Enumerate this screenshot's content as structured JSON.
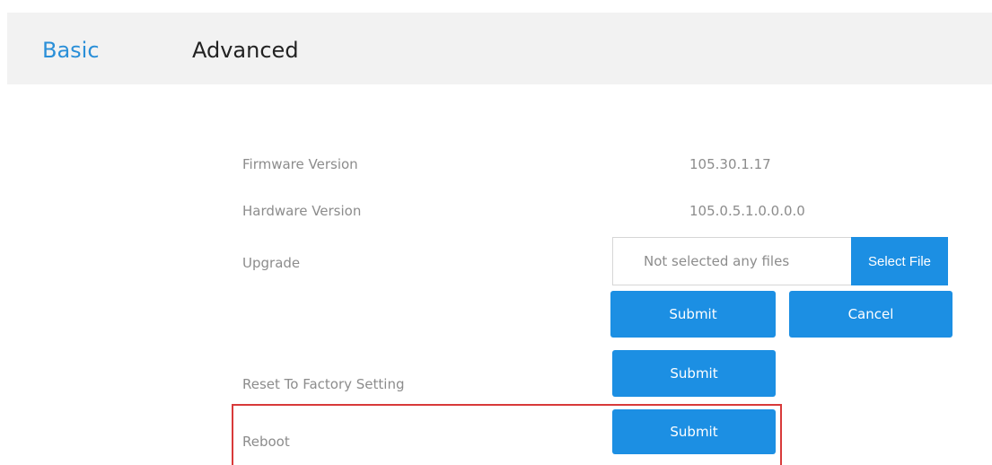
{
  "tabs": {
    "basic": "Basic",
    "advanced": "Advanced"
  },
  "firmware": {
    "label": "Firmware Version",
    "value": "105.30.1.17"
  },
  "hardware": {
    "label": "Hardware Version",
    "value": "105.0.5.1.0.0.0.0"
  },
  "upgrade": {
    "label": "Upgrade",
    "file_placeholder": "Not selected any files",
    "select_file_label": "Select File",
    "submit_label": "Submit",
    "cancel_label": "Cancel"
  },
  "factory_reset": {
    "label": "Reset To Factory Setting",
    "submit_label": "Submit"
  },
  "reboot": {
    "label": "Reboot",
    "submit_label": "Submit"
  },
  "colors": {
    "accent": "#1c8fe3",
    "tab_active_link": "#2a8fd8",
    "highlight_border": "#d83a3a",
    "tabbar_bg": "#f2f2f2",
    "label_text": "#8c8c8c"
  }
}
